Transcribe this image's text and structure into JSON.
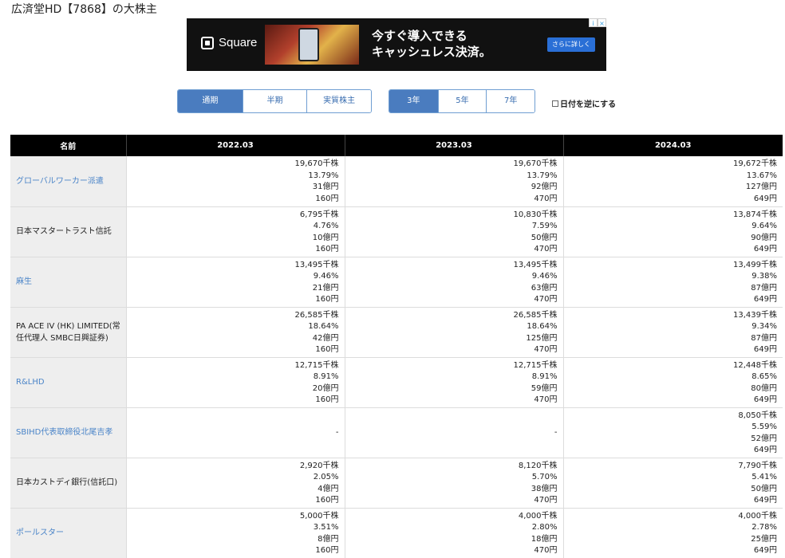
{
  "page": {
    "title": "広済堂HD【7868】の大株主"
  },
  "ad": {
    "brand": "Square",
    "headline_line1": "今すぐ導入できる",
    "headline_line2": "キャッシュレス決済。",
    "cta": "さらに詳しく"
  },
  "tabs": {
    "period": [
      {
        "label": "通期",
        "active": true
      },
      {
        "label": "半期",
        "active": false
      },
      {
        "label": "実質株主",
        "active": false
      }
    ],
    "years": [
      {
        "label": "3年",
        "active": true
      },
      {
        "label": "5年",
        "active": false
      },
      {
        "label": "7年",
        "active": false
      }
    ],
    "reverse_label": "日付を逆にする"
  },
  "table": {
    "headers": [
      "名前",
      "2022.03",
      "2023.03",
      "2024.03"
    ],
    "rows": [
      {
        "name": "グローバルワーカー派遣",
        "link": true,
        "cells": [
          [
            "19,670千株",
            "13.79%",
            "31億円",
            "160円"
          ],
          [
            "19,670千株",
            "13.79%",
            "92億円",
            "470円"
          ],
          [
            "19,672千株",
            "13.67%",
            "127億円",
            "649円"
          ]
        ]
      },
      {
        "name": "日本マスタートラスト信託",
        "link": false,
        "cells": [
          [
            "6,795千株",
            "4.76%",
            "10億円",
            "160円"
          ],
          [
            "10,830千株",
            "7.59%",
            "50億円",
            "470円"
          ],
          [
            "13,874千株",
            "9.64%",
            "90億円",
            "649円"
          ]
        ]
      },
      {
        "name": "麻生",
        "link": true,
        "cells": [
          [
            "13,495千株",
            "9.46%",
            "21億円",
            "160円"
          ],
          [
            "13,495千株",
            "9.46%",
            "63億円",
            "470円"
          ],
          [
            "13,499千株",
            "9.38%",
            "87億円",
            "649円"
          ]
        ]
      },
      {
        "name": "PA ACE IV (HK) LIMITED(常任代理人 SMBC日興証券)",
        "link": false,
        "cells": [
          [
            "26,585千株",
            "18.64%",
            "42億円",
            "160円"
          ],
          [
            "26,585千株",
            "18.64%",
            "125億円",
            "470円"
          ],
          [
            "13,439千株",
            "9.34%",
            "87億円",
            "649円"
          ]
        ]
      },
      {
        "name": "R&LHD",
        "link": true,
        "cells": [
          [
            "12,715千株",
            "8.91%",
            "20億円",
            "160円"
          ],
          [
            "12,715千株",
            "8.91%",
            "59億円",
            "470円"
          ],
          [
            "12,448千株",
            "8.65%",
            "80億円",
            "649円"
          ]
        ]
      },
      {
        "name": "SBIHD代表取締役北尾吉孝",
        "link": true,
        "cells": [
          [
            "-"
          ],
          [
            "-"
          ],
          [
            "8,050千株",
            "5.59%",
            "52億円",
            "649円"
          ]
        ]
      },
      {
        "name": "日本カストディ銀行(信託口)",
        "link": false,
        "cells": [
          [
            "2,920千株",
            "2.05%",
            "4億円",
            "160円"
          ],
          [
            "8,120千株",
            "5.70%",
            "38億円",
            "470円"
          ],
          [
            "7,790千株",
            "5.41%",
            "50億円",
            "649円"
          ]
        ]
      },
      {
        "name": "ポールスター",
        "link": true,
        "cells": [
          [
            "5,000千株",
            "3.51%",
            "8億円",
            "160円"
          ],
          [
            "4,000千株",
            "2.80%",
            "18億円",
            "470円"
          ],
          [
            "4,000千株",
            "2.78%",
            "25億円",
            "649円"
          ]
        ]
      }
    ]
  }
}
